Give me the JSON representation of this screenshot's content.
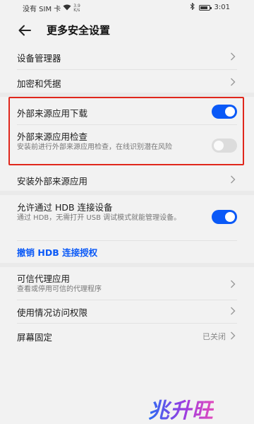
{
  "status_bar": {
    "carrier": "没有 SIM 卡",
    "net_speed_value": "3.9",
    "net_speed_unit": "K/s",
    "time": "3:01"
  },
  "header": {
    "title": "更多安全设置"
  },
  "items": {
    "device_admin": "设备管理器",
    "encryption": "加密和凭据",
    "external_download": "外部来源应用下载",
    "external_check": "外部来源应用检查",
    "external_check_desc": "安装前进行外部来源应用检查，在线识别潜在风险",
    "install_external": "安装外部来源应用",
    "hdb_allow": "允许通过 HDB 连接设备",
    "hdb_allow_desc": "通过 HDB，无需打开 USB 调试模式就能管理设备。",
    "hdb_revoke": "撤销 HDB 连接授权",
    "trust_agent": "可信代理应用",
    "trust_agent_desc": "查看或停用可信的代理程序",
    "usage_access": "使用情况访问权限",
    "screen_pin": "屏幕固定",
    "screen_pin_value": "已关闭"
  },
  "toggles": {
    "external_download": "on",
    "external_check": "off",
    "hdb_allow": "on"
  },
  "watermark": "兆升旺",
  "colors": {
    "accent": "#0a59f7",
    "highlight_border": "#e0271c"
  }
}
